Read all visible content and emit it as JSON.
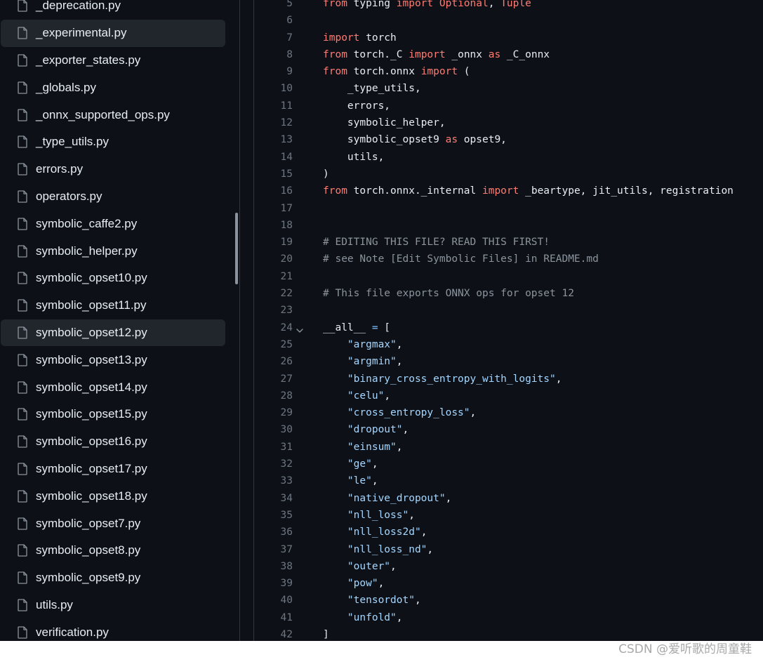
{
  "sidebar": {
    "files": [
      {
        "name": "_deprecation.py",
        "active": false
      },
      {
        "name": "_experimental.py",
        "active": true
      },
      {
        "name": "_exporter_states.py",
        "active": false
      },
      {
        "name": "_globals.py",
        "active": false
      },
      {
        "name": "_onnx_supported_ops.py",
        "active": false
      },
      {
        "name": "_type_utils.py",
        "active": false
      },
      {
        "name": "errors.py",
        "active": false
      },
      {
        "name": "operators.py",
        "active": false
      },
      {
        "name": "symbolic_caffe2.py",
        "active": false
      },
      {
        "name": "symbolic_helper.py",
        "active": false
      },
      {
        "name": "symbolic_opset10.py",
        "active": false
      },
      {
        "name": "symbolic_opset11.py",
        "active": false
      },
      {
        "name": "symbolic_opset12.py",
        "active": true
      },
      {
        "name": "symbolic_opset13.py",
        "active": false
      },
      {
        "name": "symbolic_opset14.py",
        "active": false
      },
      {
        "name": "symbolic_opset15.py",
        "active": false
      },
      {
        "name": "symbolic_opset16.py",
        "active": false
      },
      {
        "name": "symbolic_opset17.py",
        "active": false
      },
      {
        "name": "symbolic_opset18.py",
        "active": false
      },
      {
        "name": "symbolic_opset7.py",
        "active": false
      },
      {
        "name": "symbolic_opset8.py",
        "active": false
      },
      {
        "name": "symbolic_opset9.py",
        "active": false
      },
      {
        "name": "utils.py",
        "active": false
      },
      {
        "name": "verification.py",
        "active": false
      }
    ]
  },
  "code": {
    "lines": [
      {
        "n": "5",
        "tokens": [
          [
            "kw",
            "from"
          ],
          [
            "plain",
            " typing "
          ],
          [
            "kw",
            "import"
          ],
          [
            "plain",
            " "
          ],
          [
            "kw",
            "Optional"
          ],
          [
            "plain",
            ", "
          ],
          [
            "kw",
            "Tuple"
          ]
        ]
      },
      {
        "n": "6",
        "tokens": []
      },
      {
        "n": "7",
        "tokens": [
          [
            "kw",
            "import"
          ],
          [
            "plain",
            " torch"
          ]
        ]
      },
      {
        "n": "8",
        "tokens": [
          [
            "kw",
            "from"
          ],
          [
            "plain",
            " torch._C "
          ],
          [
            "kw",
            "import"
          ],
          [
            "plain",
            " _onnx "
          ],
          [
            "kw",
            "as"
          ],
          [
            "plain",
            " _C_onnx"
          ]
        ]
      },
      {
        "n": "9",
        "tokens": [
          [
            "kw",
            "from"
          ],
          [
            "plain",
            " torch.onnx "
          ],
          [
            "kw",
            "import"
          ],
          [
            "plain",
            " ("
          ]
        ]
      },
      {
        "n": "10",
        "tokens": [
          [
            "plain",
            "    _type_utils,"
          ]
        ]
      },
      {
        "n": "11",
        "tokens": [
          [
            "plain",
            "    errors,"
          ]
        ]
      },
      {
        "n": "12",
        "tokens": [
          [
            "plain",
            "    symbolic_helper,"
          ]
        ]
      },
      {
        "n": "13",
        "tokens": [
          [
            "plain",
            "    symbolic_opset9 "
          ],
          [
            "kw",
            "as"
          ],
          [
            "plain",
            " opset9,"
          ]
        ]
      },
      {
        "n": "14",
        "tokens": [
          [
            "plain",
            "    utils,"
          ]
        ]
      },
      {
        "n": "15",
        "tokens": [
          [
            "plain",
            ")"
          ]
        ]
      },
      {
        "n": "16",
        "tokens": [
          [
            "kw",
            "from"
          ],
          [
            "plain",
            " torch.onnx._internal "
          ],
          [
            "kw",
            "import"
          ],
          [
            "plain",
            " _beartype, jit_utils, registration"
          ]
        ]
      },
      {
        "n": "17",
        "tokens": []
      },
      {
        "n": "18",
        "tokens": []
      },
      {
        "n": "19",
        "tokens": [
          [
            "com",
            "# EDITING THIS FILE? READ THIS FIRST!"
          ]
        ]
      },
      {
        "n": "20",
        "tokens": [
          [
            "com",
            "# see Note [Edit Symbolic Files] in README.md"
          ]
        ]
      },
      {
        "n": "21",
        "tokens": []
      },
      {
        "n": "22",
        "tokens": [
          [
            "com",
            "# This file exports ONNX ops for opset 12"
          ]
        ]
      },
      {
        "n": "23",
        "tokens": []
      },
      {
        "n": "24",
        "fold": true,
        "tokens": [
          [
            "plain",
            "__all__ "
          ],
          [
            "op",
            "="
          ],
          [
            "plain",
            " ["
          ]
        ]
      },
      {
        "n": "25",
        "tokens": [
          [
            "plain",
            "    "
          ],
          [
            "str",
            "\"argmax\""
          ],
          [
            "plain",
            ","
          ]
        ]
      },
      {
        "n": "26",
        "tokens": [
          [
            "plain",
            "    "
          ],
          [
            "str",
            "\"argmin\""
          ],
          [
            "plain",
            ","
          ]
        ]
      },
      {
        "n": "27",
        "tokens": [
          [
            "plain",
            "    "
          ],
          [
            "str",
            "\"binary_cross_entropy_with_logits\""
          ],
          [
            "plain",
            ","
          ]
        ]
      },
      {
        "n": "28",
        "tokens": [
          [
            "plain",
            "    "
          ],
          [
            "str",
            "\"celu\""
          ],
          [
            "plain",
            ","
          ]
        ]
      },
      {
        "n": "29",
        "tokens": [
          [
            "plain",
            "    "
          ],
          [
            "str",
            "\"cross_entropy_loss\""
          ],
          [
            "plain",
            ","
          ]
        ]
      },
      {
        "n": "30",
        "tokens": [
          [
            "plain",
            "    "
          ],
          [
            "str",
            "\"dropout\""
          ],
          [
            "plain",
            ","
          ]
        ]
      },
      {
        "n": "31",
        "tokens": [
          [
            "plain",
            "    "
          ],
          [
            "str",
            "\"einsum\""
          ],
          [
            "plain",
            ","
          ]
        ]
      },
      {
        "n": "32",
        "tokens": [
          [
            "plain",
            "    "
          ],
          [
            "str",
            "\"ge\""
          ],
          [
            "plain",
            ","
          ]
        ]
      },
      {
        "n": "33",
        "tokens": [
          [
            "plain",
            "    "
          ],
          [
            "str",
            "\"le\""
          ],
          [
            "plain",
            ","
          ]
        ]
      },
      {
        "n": "34",
        "tokens": [
          [
            "plain",
            "    "
          ],
          [
            "str",
            "\"native_dropout\""
          ],
          [
            "plain",
            ","
          ]
        ]
      },
      {
        "n": "35",
        "tokens": [
          [
            "plain",
            "    "
          ],
          [
            "str",
            "\"nll_loss\""
          ],
          [
            "plain",
            ","
          ]
        ]
      },
      {
        "n": "36",
        "tokens": [
          [
            "plain",
            "    "
          ],
          [
            "str",
            "\"nll_loss2d\""
          ],
          [
            "plain",
            ","
          ]
        ]
      },
      {
        "n": "37",
        "tokens": [
          [
            "plain",
            "    "
          ],
          [
            "str",
            "\"nll_loss_nd\""
          ],
          [
            "plain",
            ","
          ]
        ]
      },
      {
        "n": "38",
        "tokens": [
          [
            "plain",
            "    "
          ],
          [
            "str",
            "\"outer\""
          ],
          [
            "plain",
            ","
          ]
        ]
      },
      {
        "n": "39",
        "tokens": [
          [
            "plain",
            "    "
          ],
          [
            "str",
            "\"pow\""
          ],
          [
            "plain",
            ","
          ]
        ]
      },
      {
        "n": "40",
        "tokens": [
          [
            "plain",
            "    "
          ],
          [
            "str",
            "\"tensordot\""
          ],
          [
            "plain",
            ","
          ]
        ]
      },
      {
        "n": "41",
        "tokens": [
          [
            "plain",
            "    "
          ],
          [
            "str",
            "\"unfold\""
          ],
          [
            "plain",
            ","
          ]
        ]
      },
      {
        "n": "42",
        "tokens": [
          [
            "plain",
            "]"
          ]
        ]
      }
    ]
  },
  "footer": {
    "watermark": "CSDN @爱听歌的周童鞋"
  },
  "colors": {
    "background": "#0d1117",
    "keyword": "#ff7b72",
    "string": "#a5d6ff",
    "comment": "#8b949e",
    "operator": "#79c0ff",
    "line_number": "#6e7681",
    "active_row": "#21262d"
  },
  "icons": {
    "file": "file-icon",
    "fold": "chevron-down-icon"
  }
}
